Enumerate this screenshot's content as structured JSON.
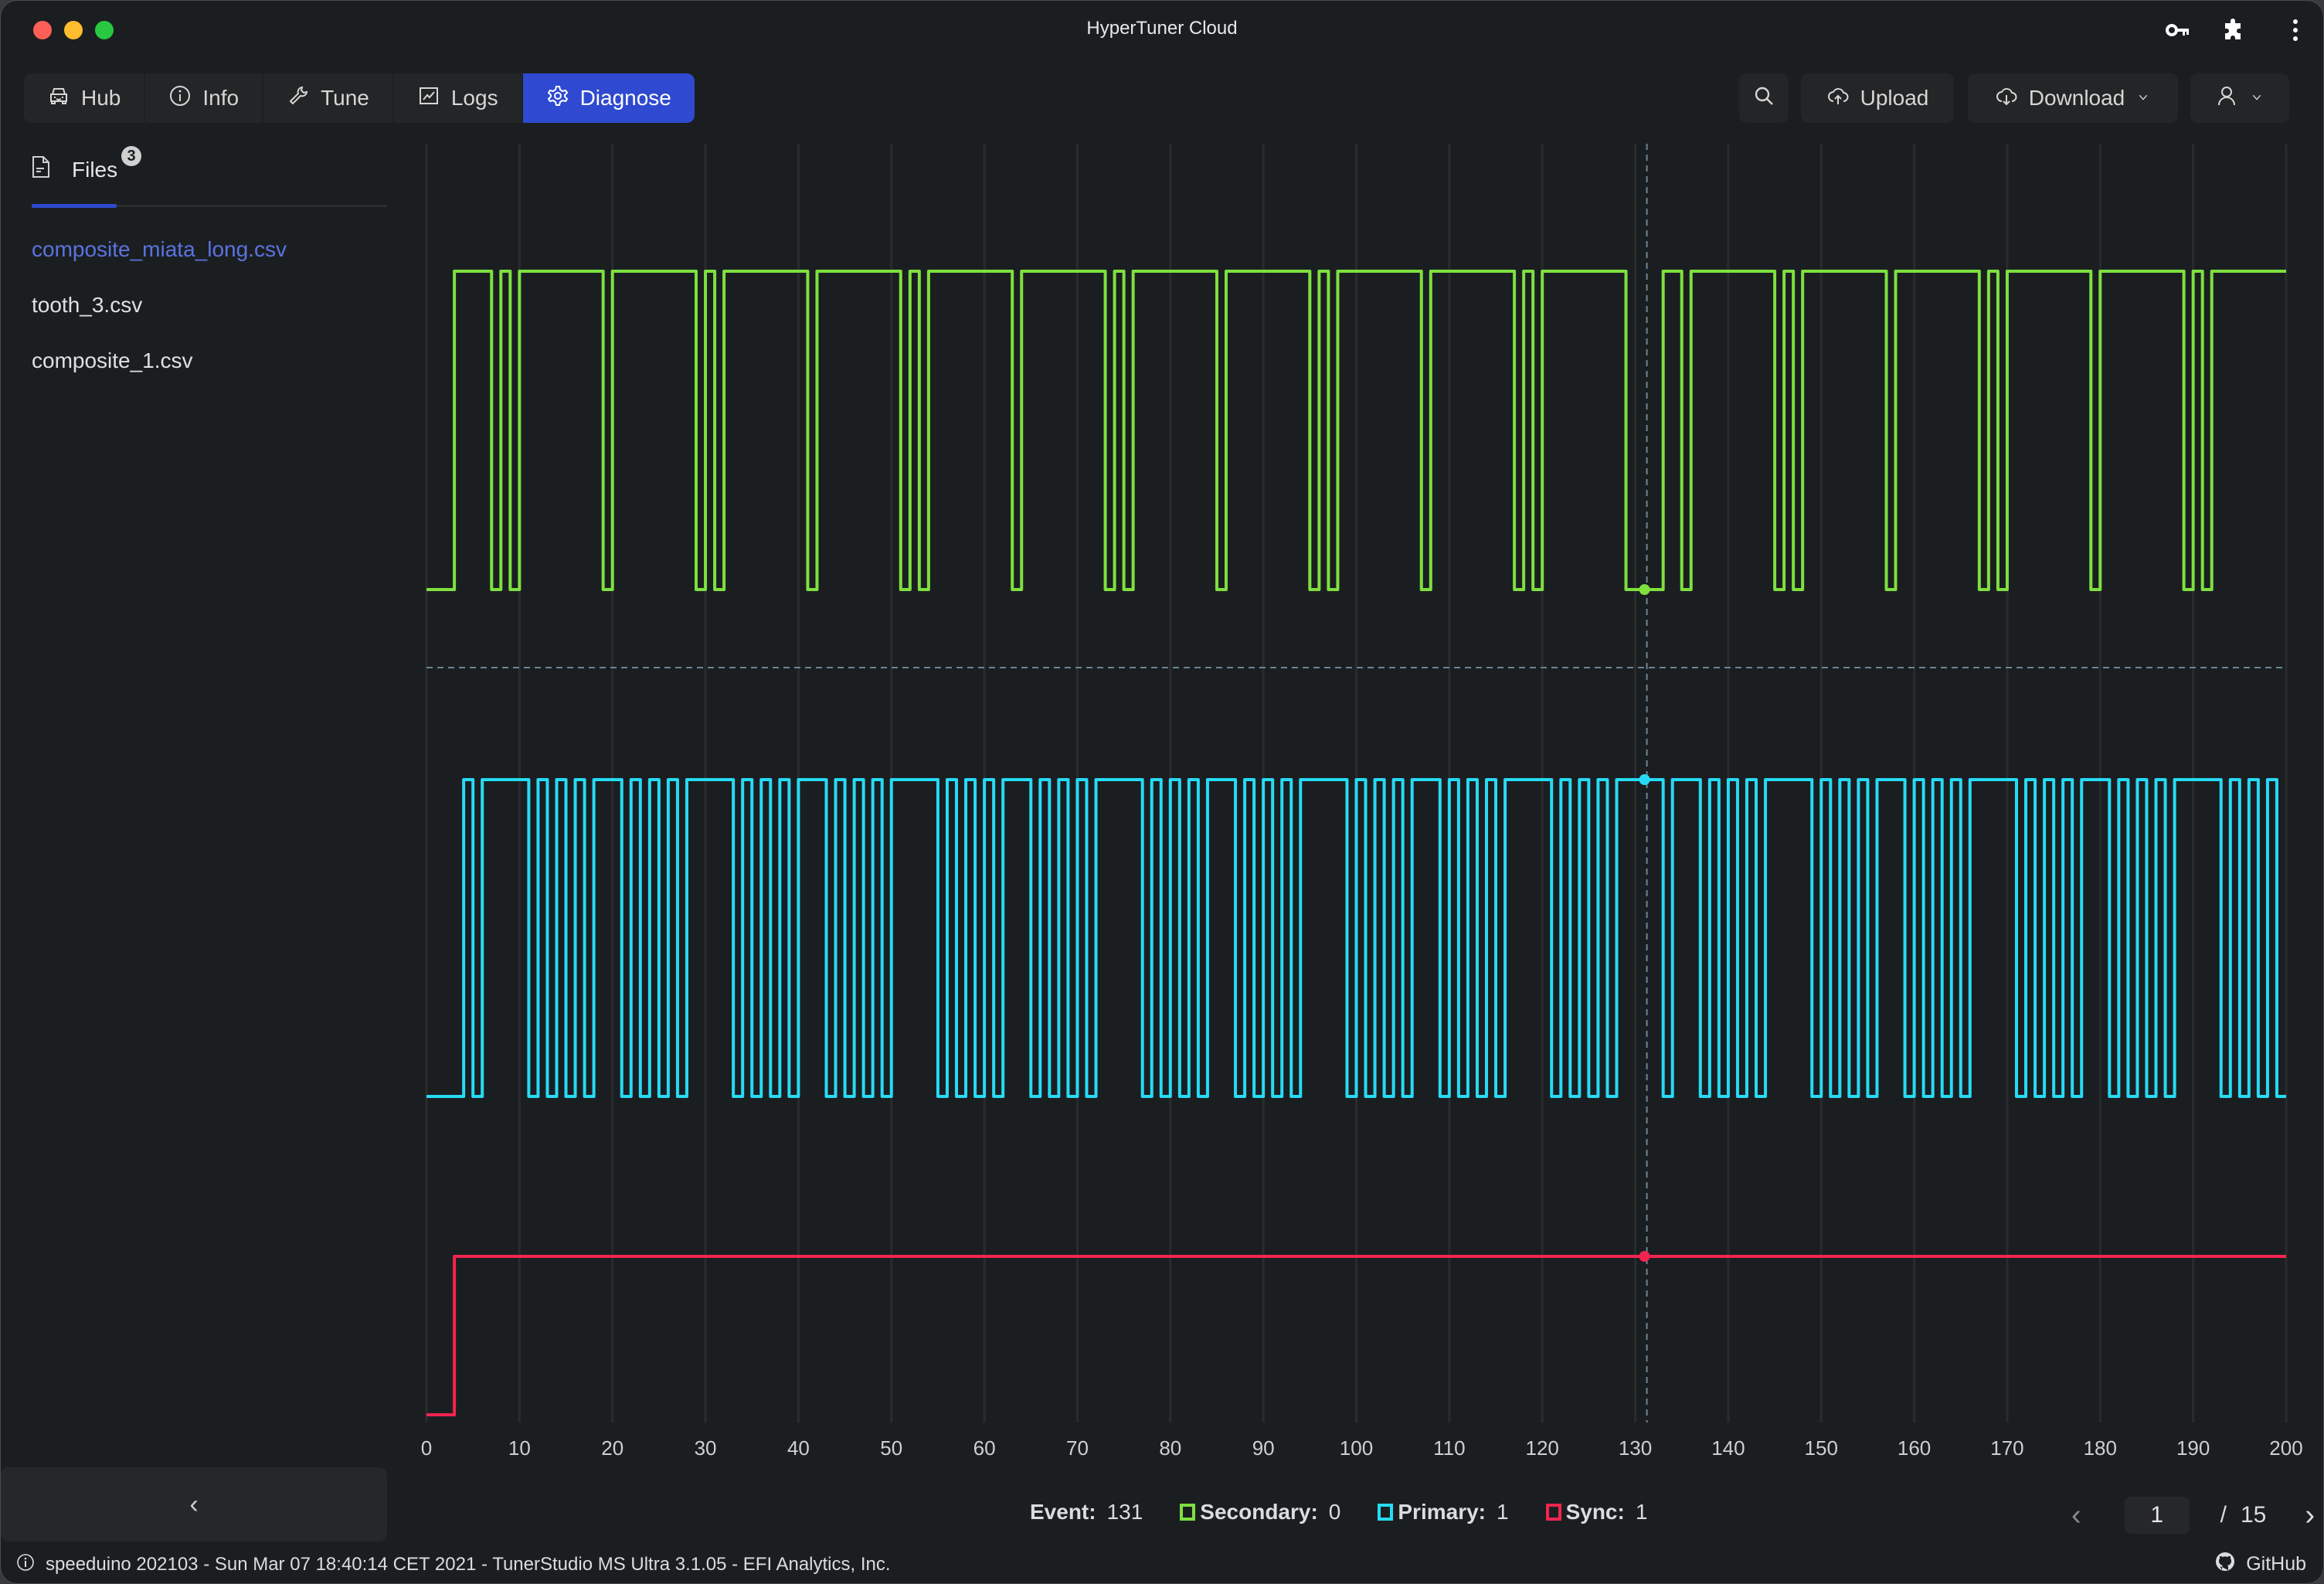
{
  "window": {
    "title": "HyperTuner Cloud"
  },
  "titlebar_icons": [
    "key-icon",
    "puzzle-icon",
    "more-vertical-icon"
  ],
  "nav": {
    "tabs": [
      {
        "label": "Hub",
        "icon": "car-icon",
        "active": false
      },
      {
        "label": "Info",
        "icon": "info-circle-icon",
        "active": false
      },
      {
        "label": "Tune",
        "icon": "wrench-icon",
        "active": false
      },
      {
        "label": "Logs",
        "icon": "line-chart-icon",
        "active": false
      },
      {
        "label": "Diagnose",
        "icon": "gear-icon",
        "active": true
      }
    ],
    "search_icon": "search-icon",
    "upload_label": "Upload",
    "download_label": "Download",
    "user_icon": "user-icon"
  },
  "sidebar": {
    "tab_label": "Files",
    "badge_count": "3",
    "files": [
      {
        "name": "composite_miata_long.csv",
        "active": true
      },
      {
        "name": "tooth_3.csv",
        "active": false
      },
      {
        "name": "composite_1.csv",
        "active": false
      }
    ],
    "collapse_glyph": "‹"
  },
  "colors": {
    "accent": "#2f4ad0",
    "secondary": "#7ee03f",
    "primary": "#26dbf5",
    "sync": "#f2254f",
    "crosshair": "#6b8591"
  },
  "legend": {
    "event_label": "Event:",
    "event_value": "131",
    "secondary_label": "Secondary:",
    "secondary_value": "0",
    "primary_label": "Primary:",
    "primary_value": "1",
    "sync_label": "Sync:",
    "sync_value": "1"
  },
  "pager": {
    "current": "1",
    "separator": "/",
    "total": "15",
    "prev_glyph": "‹",
    "next_glyph": "›"
  },
  "status": {
    "text": "speeduino 202103 - Sun Mar 07 18:40:14 CET 2021 - TunerStudio MS Ultra 3.1.05 - EFI Analytics, Inc.",
    "github_label": "GitHub"
  },
  "chart_data": {
    "type": "line",
    "subtype": "step",
    "title": "",
    "xlabel": "",
    "ylabel": "",
    "xlim": [
      0,
      200
    ],
    "x_ticks": [
      0,
      10,
      20,
      30,
      40,
      50,
      60,
      70,
      80,
      90,
      100,
      110,
      120,
      130,
      140,
      150,
      160,
      170,
      180,
      190,
      200
    ],
    "grid": true,
    "cursor_event": 131,
    "series": [
      {
        "name": "Secondary",
        "color": "#7ee03f",
        "initial": 0,
        "toggles": [
          3,
          7,
          8,
          9,
          10,
          19,
          20,
          29,
          30,
          31,
          32,
          41,
          42,
          51,
          52,
          53,
          54,
          63,
          64,
          73,
          74,
          75,
          76,
          85,
          86,
          95,
          96,
          97,
          98,
          107,
          108,
          117,
          118,
          119,
          120,
          129,
          133,
          135,
          136,
          145,
          146,
          147,
          148,
          157,
          158,
          167,
          168,
          169,
          170,
          179,
          180,
          189,
          190,
          191,
          192
        ],
        "cursor_value": 0
      },
      {
        "name": "Primary",
        "color": "#26dbf5",
        "initial": 0,
        "toggles": [
          4,
          5,
          6,
          11,
          12,
          13,
          14,
          15,
          16,
          17,
          18,
          21,
          22,
          23,
          24,
          25,
          26,
          27,
          28,
          33,
          34,
          35,
          36,
          37,
          38,
          39,
          40,
          43,
          44,
          45,
          46,
          47,
          48,
          49,
          50,
          55,
          56,
          57,
          58,
          59,
          60,
          61,
          62,
          65,
          66,
          67,
          68,
          69,
          70,
          71,
          72,
          77,
          78,
          79,
          80,
          81,
          82,
          83,
          84,
          87,
          88,
          89,
          90,
          91,
          92,
          93,
          94,
          99,
          100,
          101,
          102,
          103,
          104,
          105,
          106,
          109,
          110,
          111,
          112,
          113,
          114,
          115,
          116,
          121,
          122,
          123,
          124,
          125,
          126,
          127,
          128,
          133,
          134,
          137,
          138,
          139,
          140,
          141,
          142,
          143,
          144,
          149,
          150,
          151,
          152,
          153,
          154,
          155,
          156,
          159,
          160,
          161,
          162,
          163,
          164,
          165,
          166,
          171,
          172,
          173,
          174,
          175,
          176,
          177,
          178,
          181,
          182,
          183,
          184,
          185,
          186,
          187,
          188,
          193,
          194,
          195,
          196,
          197,
          198,
          199
        ],
        "cursor_value": 1
      },
      {
        "name": "Sync",
        "color": "#f2254f",
        "initial": 0,
        "toggles": [
          3
        ],
        "cursor_value": 1
      }
    ]
  }
}
